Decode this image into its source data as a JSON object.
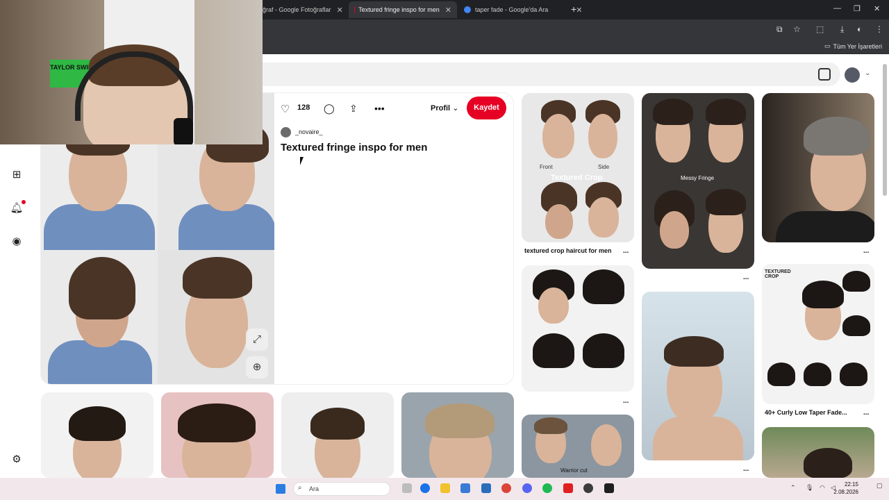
{
  "browser": {
    "tabs": [
      {
        "label": "ğraf - Google Fotoğraflar",
        "active": false
      },
      {
        "label": "Textured fringe inspo for men",
        "active": true
      },
      {
        "label": "taper fade - Google'da Ara",
        "active": false
      }
    ],
    "bookmarks_folder": "Tüm Yer İşaretleri"
  },
  "pin": {
    "like_count": "128",
    "profile_label": "Profil",
    "save_label": "Kaydet",
    "creator": "_novaire_",
    "title": "Textured fringe inspo for men"
  },
  "grid": {
    "tile1": {
      "caption": "textured crop haircut for men",
      "front": "Front",
      "side": "Side",
      "overlay": "Textured Crop"
    },
    "tile2": {
      "overlay": "Messy Fringe"
    },
    "tile3": {
      "caption": "40+ Curly Low Taper Fade...",
      "header": "TEXTURED CROP"
    },
    "tile4": {
      "overlay": "Warrior cut"
    }
  },
  "more_label": "...",
  "webcam": {
    "poster": "TAYLOR SWIFT"
  },
  "taskbar": {
    "search_placeholder": "Ara",
    "time": "22:15",
    "date": "2.08.2026"
  },
  "colors": {
    "accent": "#e60023",
    "taskbar": "#f2e8ec"
  }
}
